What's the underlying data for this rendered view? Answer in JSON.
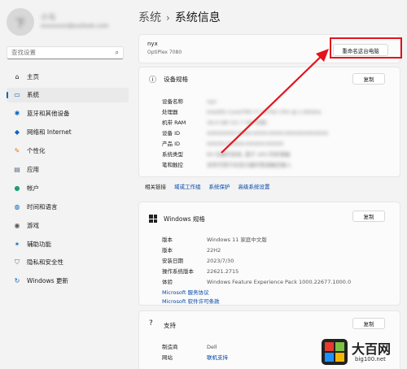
{
  "sidebar": {
    "user_initial": "下",
    "user_name": "小马",
    "user_email": "xxxxxxxx@outlook.com",
    "search_placeholder": "查找设置",
    "items": [
      {
        "label": "主页",
        "icon": "home-icon"
      },
      {
        "label": "系统",
        "icon": "system-icon"
      },
      {
        "label": "蓝牙和其他设备",
        "icon": "bluetooth-icon"
      },
      {
        "label": "网络和 Internet",
        "icon": "network-icon"
      },
      {
        "label": "个性化",
        "icon": "brush-icon"
      },
      {
        "label": "应用",
        "icon": "apps-icon"
      },
      {
        "label": "帐户",
        "icon": "account-icon"
      },
      {
        "label": "时间和语言",
        "icon": "globe-icon"
      },
      {
        "label": "游戏",
        "icon": "gaming-icon"
      },
      {
        "label": "辅助功能",
        "icon": "accessibility-icon"
      },
      {
        "label": "隐私和安全性",
        "icon": "shield-icon"
      },
      {
        "label": "Windows 更新",
        "icon": "update-icon"
      }
    ],
    "active_index": 1
  },
  "header": {
    "parent": "系统",
    "separator": "›",
    "title": "系统信息"
  },
  "device": {
    "name": "nyx",
    "model": "OptiPlex 7080",
    "rename_label": "重命名这台电脑"
  },
  "device_specs": {
    "title": "设备规格",
    "copy_label": "复制",
    "rows": [
      {
        "key": "设备名称",
        "value": "nyx"
      },
      {
        "key": "处理器",
        "value": "Intel(R) Core(TM) i7-10700 CPU @ 2.90GHz"
      },
      {
        "key": "机带 RAM",
        "value": "16.0 GB (15.7 GB 可用)"
      },
      {
        "key": "设备 ID",
        "value": "XXXXXXXX-XXXX-XXXX-XXXX-XXXXXXXXXXXX"
      },
      {
        "key": "产品 ID",
        "value": "XXXXX-XXXXX-XXXXX-XXXXX"
      },
      {
        "key": "系统类型",
        "value": "64 位操作系统, 基于 x64 的处理器"
      },
      {
        "key": "笔和触控",
        "value": "没有可用于此显示器的笔或触控输入"
      }
    ]
  },
  "related": {
    "label": "相关链接",
    "links": [
      "域或工作组",
      "系统保护",
      "高级系统设置"
    ]
  },
  "windows_specs": {
    "title": "Windows 规格",
    "copy_label": "复制",
    "rows": [
      {
        "key": "版本",
        "value": "Windows 11 家庭中文版"
      },
      {
        "key": "版本",
        "value": "22H2"
      },
      {
        "key": "安装日期",
        "value": "2023/7/30"
      },
      {
        "key": "操作系统版本",
        "value": "22621.2715"
      },
      {
        "key": "体验",
        "value": "Windows Feature Experience Pack 1000.22677.1000.0"
      }
    ],
    "links": [
      "Microsoft 服务协议",
      "Microsoft 软件许可条款"
    ]
  },
  "support": {
    "title": "支持",
    "copy_label": "复制",
    "rows": [
      {
        "key": "制造商",
        "value": "Dell"
      },
      {
        "key": "网站",
        "value": "联机支持"
      }
    ]
  },
  "watermark": {
    "text": "大百网",
    "url": "big100.net"
  },
  "colors": {
    "accent": "#0067c0",
    "highlight": "#e3141b",
    "link": "#0046a8"
  }
}
